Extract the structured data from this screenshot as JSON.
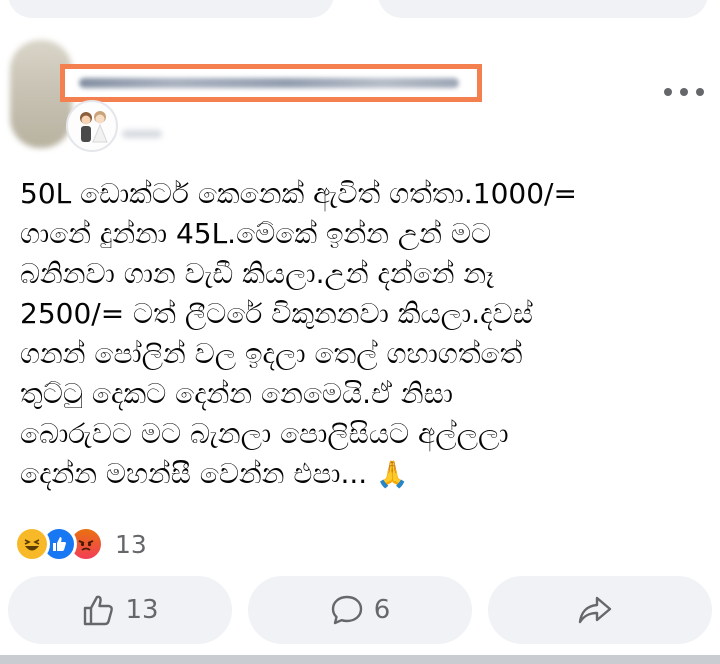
{
  "post": {
    "text": "50L ඩොක්ටර් කෙනෙක් ඇවිත් ගත්තා.1000/=\nගානේ දුන්නා 45L.මේකේ ඉන්න උන් මට\nබනිනවා ගාන වැඩී කියලා.උන් දන්නේ නෑ\n2500/= ටත් ලීටරේ විකුනනවා කියලා.දවස්\nගනන් පෝලින් වල ඉදලා තෙල් ගහාගත්තේ\nතුට්ටු දෙකට දෙන්න නෙමෙයි.ඒ නිසා\nබොරුවට මට බැනලා පොලිසියට අල්ලලා\nදෙන්න මහන්සී වෙන්න එපා... ",
    "emoji": "🙏"
  },
  "reactions": {
    "types": [
      "haha-icon",
      "like-icon",
      "angry-icon"
    ],
    "count": "13"
  },
  "actions": {
    "like_count": "13",
    "comment_count": "6"
  },
  "colors": {
    "like_blue": "#1877f2",
    "haha_yellow": "#f7b928",
    "angry_red": "#f33e58",
    "redaction_orange": "#f4804f",
    "button_gray": "#f0f2f5",
    "muted_text": "#65676b"
  }
}
